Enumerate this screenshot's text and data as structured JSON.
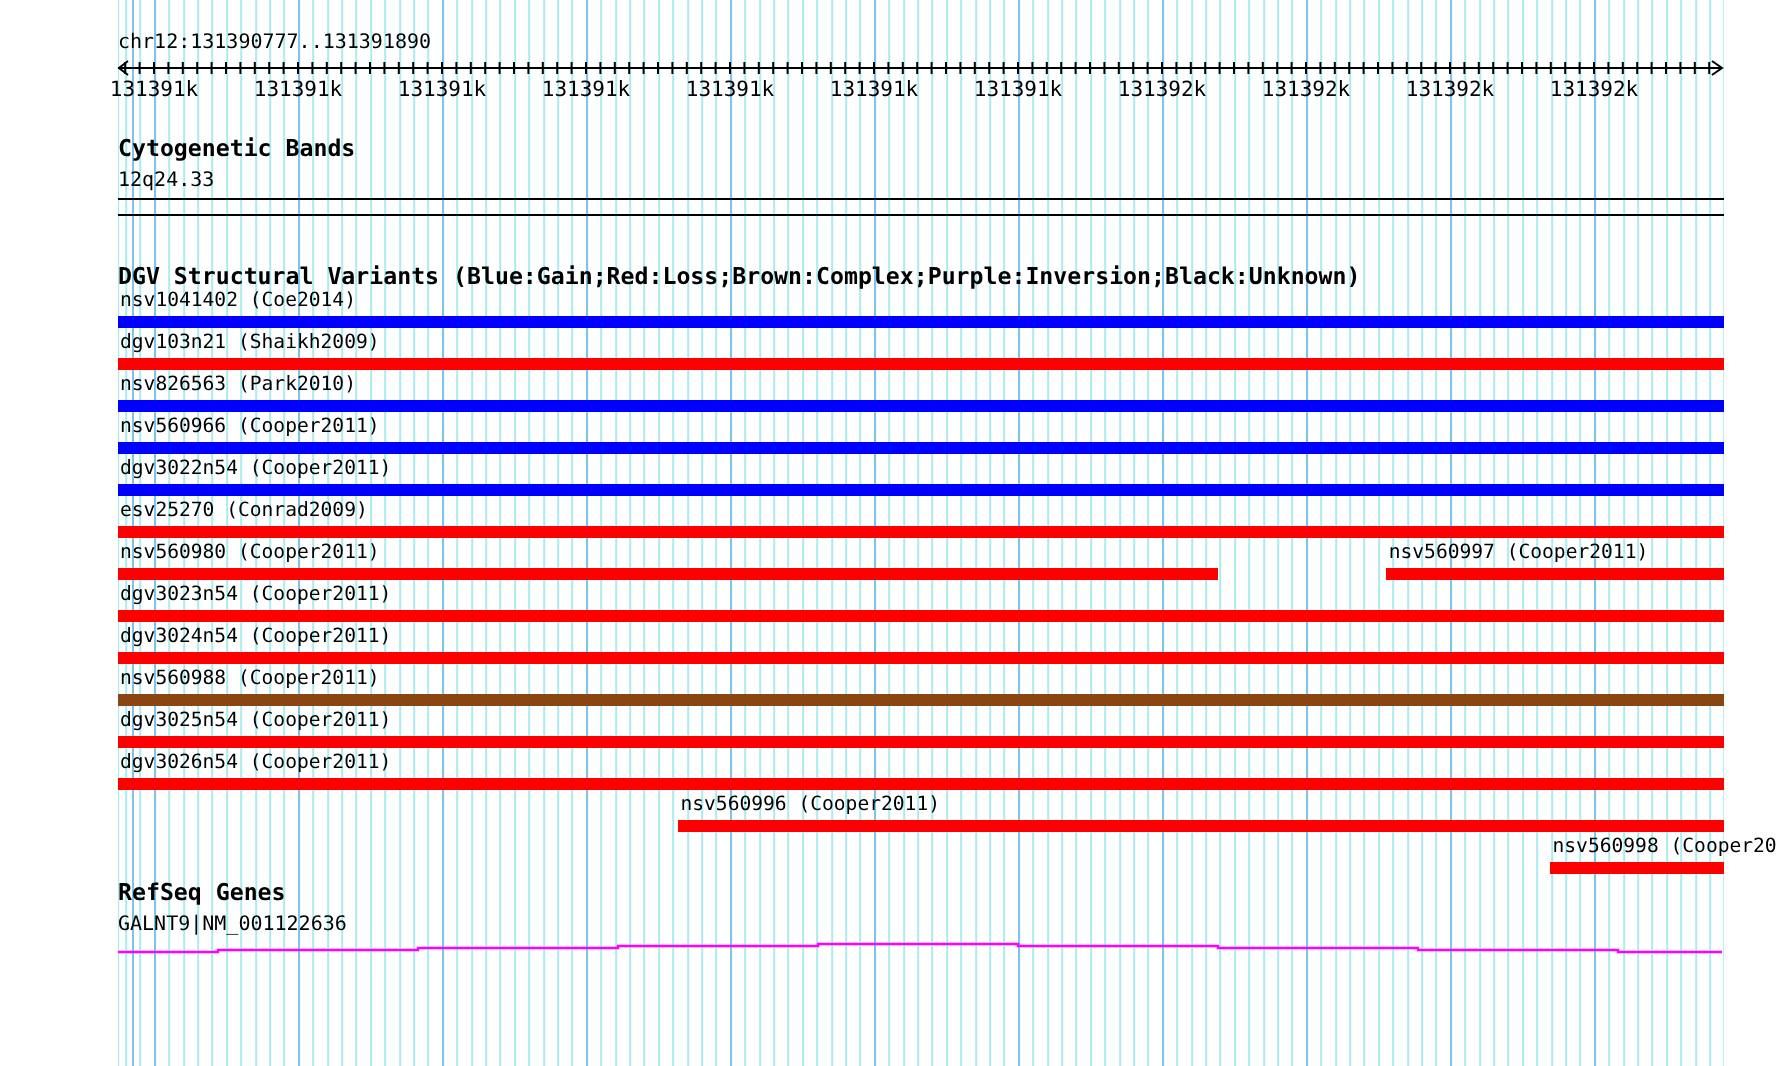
{
  "ruler": {
    "title": "chr12:131390777..131391890",
    "ticks": [
      "131391k",
      "131391k",
      "131391k",
      "131391k",
      "131391k",
      "131391k",
      "131391k",
      "131392k",
      "131392k",
      "131392k",
      "131392k"
    ]
  },
  "tracks": [
    {
      "kind": "cytoband",
      "title": "Cytogenetic Bands",
      "label": "12q24.33"
    },
    {
      "kind": "variants",
      "title": "DGV Structural Variants (Blue:Gain;Red:Loss;Brown:Complex;Purple:Inversion;Black:Unknown)",
      "rows": [
        [
          {
            "label": "nsv1041402 (Coe2014)",
            "color": "#0000ff"
          }
        ],
        [
          {
            "label": "dgv103n21 (Shaikh2009)",
            "color": "#ff0000"
          }
        ],
        [
          {
            "label": "nsv826563 (Park2010)",
            "color": "#0000ff"
          }
        ],
        [
          {
            "label": "nsv560966 (Cooper2011)",
            "color": "#0000ff"
          }
        ],
        [
          {
            "label": "dgv3022n54 (Cooper2011)",
            "color": "#0000ff"
          }
        ],
        [
          {
            "label": "esv25270 (Conrad2009)",
            "color": "#ff0000"
          }
        ],
        [
          {
            "label": "nsv560980 (Cooper2011)",
            "color": "#ff0000"
          },
          {
            "label": "nsv560997 (Cooper2011)",
            "color": "#ff0000"
          }
        ],
        [
          {
            "label": "dgv3023n54 (Cooper2011)",
            "color": "#ff0000"
          }
        ],
        [
          {
            "label": "dgv3024n54 (Cooper2011)",
            "color": "#ff0000"
          }
        ],
        [
          {
            "label": "nsv560988 (Cooper2011)",
            "color": "#8b4513"
          }
        ],
        [
          {
            "label": "dgv3025n54 (Cooper2011)",
            "color": "#ff0000"
          }
        ],
        [
          {
            "label": "dgv3026n54 (Cooper2011)",
            "color": "#ff0000"
          }
        ],
        [
          {
            "label": "nsv560996 (Cooper2011)",
            "color": "#ff0000"
          }
        ],
        [
          {
            "label": "nsv560998 (Cooper20",
            "color": "#ff0000"
          }
        ]
      ]
    },
    {
      "kind": "genes",
      "title": "RefSeq Genes",
      "label": "GALNT9|NM_001122636"
    }
  ]
}
